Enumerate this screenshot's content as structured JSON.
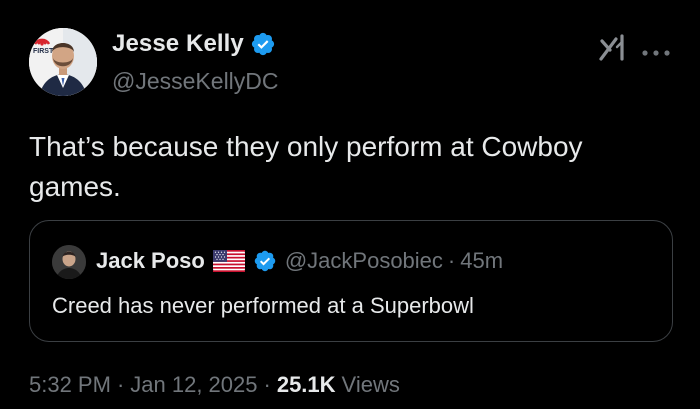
{
  "tweet": {
    "author": {
      "name": "Jesse Kelly",
      "handle": "@JesseKellyDC",
      "avatar_badge_text": "FIRST"
    },
    "text": "That’s because they only perform at Cowboy games.",
    "icons": {
      "verified": "verified-badge-icon",
      "grok": "grok-icon",
      "more": "more-icon"
    },
    "quote": {
      "author": {
        "name": "Jack Poso",
        "flag": "us-flag-icon",
        "handle": "@JackPosobiec",
        "separator": "·",
        "time": "45m"
      },
      "text": "Creed has never performed at a Superbowl"
    },
    "meta": {
      "time": "5:32 PM",
      "separator": "·",
      "date": "Jan 12, 2025",
      "views_count": "25.1K",
      "views_label": "Views"
    }
  },
  "colors": {
    "background": "#000000",
    "primary_text": "#e7e9ea",
    "secondary_text": "#71767b",
    "verified_blue": "#1d9bf0",
    "border": "#3b3f43"
  }
}
